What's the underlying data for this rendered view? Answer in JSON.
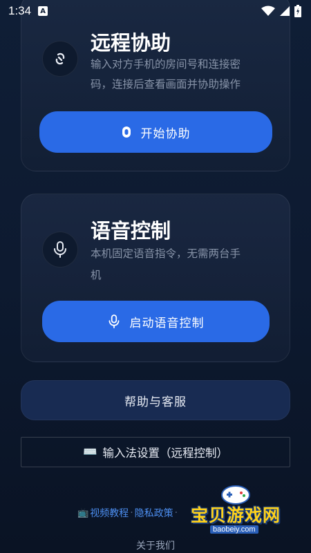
{
  "status_bar": {
    "time": "1:34",
    "notification_icon": "A"
  },
  "remote_assist": {
    "icon": "link-icon",
    "title": "远程协助",
    "desc_line1": "输入对方手机的房间号和连接密",
    "desc_line2": "码，连接后查看画面并协助操作",
    "button_label": "开始协助",
    "button_icon": "remote-icon"
  },
  "voice_control": {
    "icon": "microphone-icon",
    "title": "语音控制",
    "desc_line1": "本机固定语音指令，无需两台手",
    "desc_line2": "机",
    "button_label": "启动语音控制",
    "button_icon": "microphone-icon"
  },
  "help_button_label": "帮助与客服",
  "ime_settings": {
    "icon": "⌨️",
    "label": "输入法设置（远程控制）"
  },
  "footer_links": {
    "icon": "📺",
    "video_tutorial": "视频教程",
    "separator": "·",
    "privacy_policy": "隐私政策"
  },
  "about_label": "关于我们",
  "watermark": {
    "name": "宝贝游戏网",
    "url": "baobeiy.com"
  },
  "colors": {
    "accent": "#2a6ae6",
    "link": "#4c8ef0",
    "help_bg": "#182b52"
  }
}
